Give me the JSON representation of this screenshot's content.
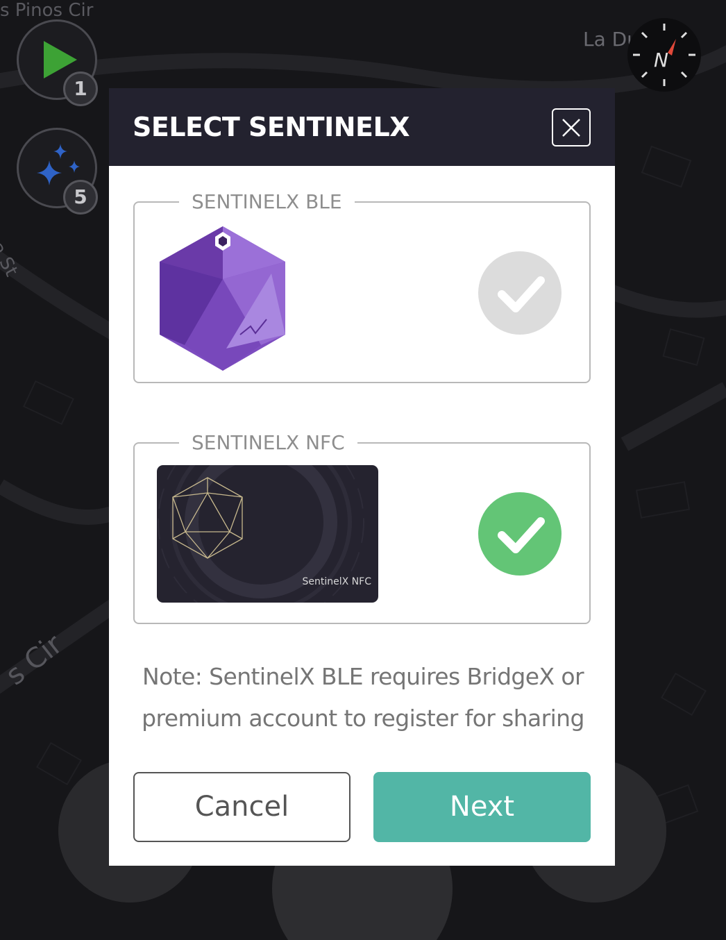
{
  "map": {
    "street_labels": [
      "s Pinos Cir",
      "La Du",
      "ea St",
      "s Cir"
    ],
    "play_badge": "1",
    "stars_badge": "5"
  },
  "dialog": {
    "title": "SELECT SENTINELX",
    "close_icon": "close-icon",
    "options": [
      {
        "legend": "SENTINELX BLE",
        "device_icon": "purple-icosahedron-tag",
        "selected": false
      },
      {
        "legend": "SENTINELX NFC",
        "device_icon": "nfc-card",
        "card_text": "SentinelX NFC",
        "selected": true
      }
    ],
    "note": "Note: SentinelX BLE requires BridgeX or premium account to register for sharing",
    "cancel_label": "Cancel",
    "next_label": "Next"
  },
  "colors": {
    "header_bg": "#23222f",
    "selected_check": "#63c576",
    "unselected_check": "#dcdcdc",
    "next_button": "#52b6a6",
    "play_icon": "#3da235",
    "stars_icon": "#2f63c7"
  }
}
